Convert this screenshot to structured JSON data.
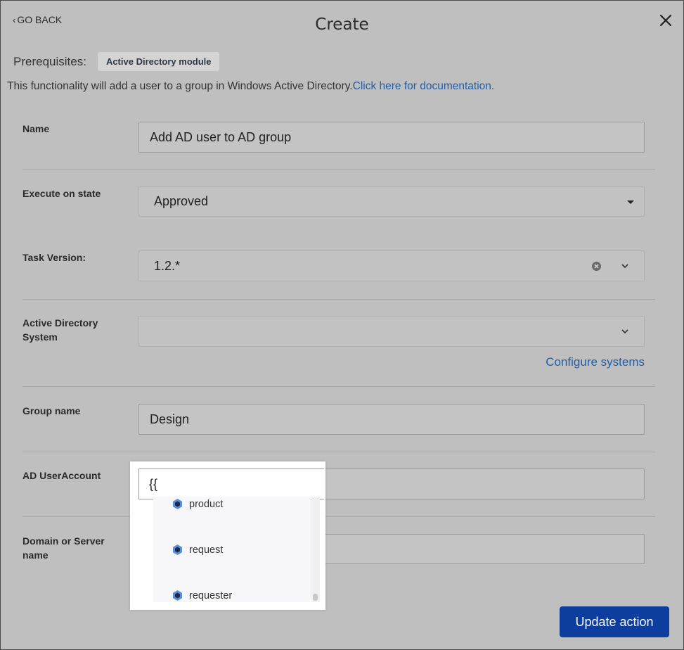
{
  "header": {
    "go_back_label": "GO BACK",
    "title": "Create",
    "close_icon": "close-icon"
  },
  "prerequisites": {
    "label": "Prerequisites:",
    "badge": "Active Directory module"
  },
  "info": {
    "text": "This functionality will add a user to a group in Windows Active Directory.",
    "link_text": "Click here for documentation."
  },
  "fields": {
    "name": {
      "label": "Name",
      "value": "Add AD user to AD group"
    },
    "execute_on_state": {
      "label": "Execute on state",
      "value": "Approved"
    },
    "task_version": {
      "label": "Task Version:",
      "value": "1.2.*"
    },
    "ad_system": {
      "label_line1": "Active Directory",
      "label_line2": "System",
      "value": ""
    },
    "configure_link": "Configure systems",
    "group_name": {
      "label": "Group name",
      "value": "Design"
    },
    "ad_user_account": {
      "label": "AD UserAccount",
      "value": "{{"
    },
    "domain": {
      "label_line1": "Domain or Server",
      "label_line2": "name",
      "value": ""
    }
  },
  "autocomplete": {
    "options": [
      "product",
      "request",
      "requester"
    ],
    "option_icon": "cube-icon"
  },
  "footer": {
    "update_label": "Update action",
    "button_color": "#0d3d9e"
  },
  "colors": {
    "link": "#1f5fa8",
    "background": "#bfbfbf"
  }
}
